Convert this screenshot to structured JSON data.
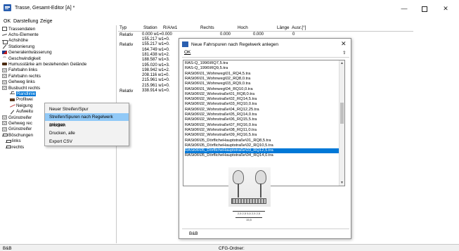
{
  "window": {
    "title": "Trasse, Gesamt-Editor  [A] *",
    "minimize": "—",
    "close": "✕"
  },
  "menu": [
    "OK",
    "Darstellung",
    "Zeige"
  ],
  "tree": [
    {
      "label": "Trassendaten",
      "icon": "data-box-icon"
    },
    {
      "label": "Achs-Elemente",
      "icon": "axis-icon"
    },
    {
      "label": "Achshöhe",
      "icon": "height-icon"
    },
    {
      "label": "Stationierung",
      "icon": "stationing-icon"
    },
    {
      "label": "Generalentwässerung",
      "icon": "drainage-icon"
    },
    {
      "label": "Geschwindigkeit",
      "icon": "speed-icon"
    },
    {
      "label": "Humusstärke am bestehenden Gelände",
      "icon": "humus-icon"
    },
    {
      "label": "Fahrbahn links",
      "icon": "lane-left-icon"
    },
    {
      "label": "Fahrbahn rechts",
      "icon": "lane-right-icon"
    },
    {
      "label": "Gehweg links",
      "icon": "sidewalk-left-icon"
    },
    {
      "label": "Busbucht rechts",
      "icon": "busbay-icon"
    },
    {
      "label": "Randlinie",
      "icon": "edge-line-icon",
      "selected": true,
      "level": 1
    },
    {
      "label": "Profilwei",
      "icon": "profile-width-icon",
      "level": 1
    },
    {
      "label": "Neigung",
      "icon": "slope-icon",
      "level": 1
    },
    {
      "label": "Aufweitu",
      "icon": "widening-icon",
      "level": 1
    },
    {
      "label": "Grünstreifer",
      "icon": "green-strip-icon"
    },
    {
      "label": "Gehweg rec",
      "icon": "sidewalk-right-icon"
    },
    {
      "label": "Grünstreifer",
      "icon": "green-strip-icon"
    },
    {
      "label": "Böschungen",
      "icon": "embankment-icon"
    },
    {
      "label": "links",
      "icon": "embankment-left-icon",
      "level": 2
    },
    {
      "label": "rechts",
      "icon": "embankment-right-icon",
      "level": 2
    }
  ],
  "table": {
    "headers": [
      "Typ",
      "Station",
      "R/A/w1",
      "Rechts",
      "Hoch",
      "Länge",
      "Ausr.[°]"
    ],
    "first_row": {
      "typ": "Relativ",
      "station": "0.000 w1=0.000",
      "rechts": "0.000",
      "hoch": "0.000",
      "ausr": "0"
    },
    "type_rows": [
      "Relativ",
      "Relativ"
    ],
    "stations": [
      "155.217 w1=0.",
      "155.217 w1=0.",
      "164.749 w1=0.",
      "181.438 w1=2.",
      "188.587 w1=3.",
      "195.020 w1=3.",
      "198.942 w1=2.",
      "208.116 w1=0.",
      "215.961 w1=0.",
      "215.961 w1=0.",
      "338.914 w1=0."
    ]
  },
  "context_menu": {
    "items": [
      "Neuer Streifen/Spur",
      "Streifen/Spuren nach Regelwerk anlegen",
      "Drucken",
      "Drucken, alle",
      "Export CSV"
    ],
    "highlighted": 1
  },
  "dialog": {
    "title": "Neue Fahrspuren nach Regelwerk anlegen",
    "ok": "OK",
    "close": "✕",
    "pin": "⇧",
    "selected_index": 17,
    "items": [
      "RAS-Q_1996\\RQ7,5.tra",
      "RAS-Q_1996\\RQ9,5.tra",
      "RASt06\\01_Wohnweg\\01_RQ4,5.tra",
      "RASt06\\01_Wohnweg\\02_RQ8,0.tra",
      "RASt06\\01_Wohnweg\\03_RQ9,0.tra",
      "RASt06\\01_Wohnweg\\04_RQ10,0.tra",
      "RASt06\\02_Wohnstraße\\01_RQ8,0.tra",
      "RASt06\\02_Wohnstraße\\02_RQ14,5.tra",
      "RASt06\\02_Wohnstraße\\03_RQ10,0.tra",
      "RASt06\\02_Wohnstraße\\04_RQ12,25.tra",
      "RASt06\\02_Wohnstraße\\05_RQ14,0.tra",
      "RASt06\\02_Wohnstraße\\06_RQ15,5.tra",
      "RASt06\\02_Wohnstraße\\07_RQ16,0.tra",
      "RASt06\\02_Wohnstraße\\08_RQ11,0.tra",
      "RASt06\\02_Wohnstraße\\09_RQ16,5.tra",
      "RASt06\\05_DörflicheHauptstraße\\01_RQ8,5.tra",
      "RASt06\\05_DörflicheHauptstraße\\02_RQ10,5.tra",
      "RASt06\\05_DörflicheHauptstraße\\03_RQ12,5.tra",
      "RASt06\\05_DörflicheHauptstraße\\04_RQ14,0.tra"
    ],
    "preview_dim_top": "2,5 2,5 5,5 2,5 2,5",
    "preview_dim_bottom": "15,5",
    "footer": "B&B"
  },
  "status": {
    "left": "B&B",
    "middle": "CFG-Ordner:"
  }
}
